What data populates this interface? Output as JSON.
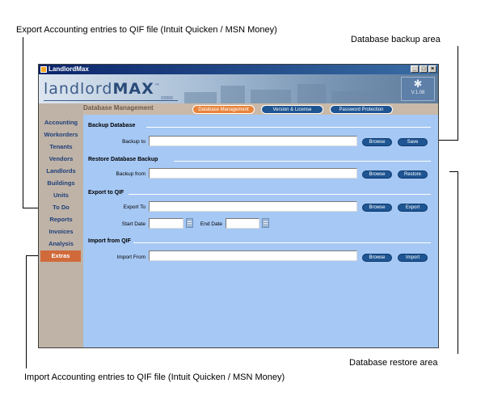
{
  "annotations": {
    "export_callout": "Export Accounting entries to QIF file (Intuit Quicken / MSN Money)",
    "backup_callout": "Database backup area",
    "restore_callout": "Database restore area",
    "import_callout": "Import Accounting entries to QIF file (Intuit Quicken / MSN Money)"
  },
  "window": {
    "title": "LandlordMax",
    "minimize": "_",
    "maximize": "□",
    "close": "×"
  },
  "banner": {
    "logo_text_light": "landlord",
    "logo_text_bold": "MAX",
    "logo_tm": "™",
    "copyright": "©2003",
    "version": "V.1.08",
    "version_icon": "snowflake-icon"
  },
  "header": {
    "section_title": "Database Management",
    "tabs": [
      {
        "label": "Database Management",
        "active": true
      },
      {
        "label": "Version & License",
        "active": false
      },
      {
        "label": "Password Protection",
        "active": false
      }
    ]
  },
  "sidebar": {
    "items": [
      {
        "label": "Accounting",
        "active": false
      },
      {
        "label": "Workorders",
        "active": false
      },
      {
        "label": "Tenants",
        "active": false
      },
      {
        "label": "Vendors",
        "active": false
      },
      {
        "label": "Landlords",
        "active": false
      },
      {
        "label": "Buildings",
        "active": false
      },
      {
        "label": "Units",
        "active": false
      },
      {
        "label": "To Do",
        "active": false
      },
      {
        "label": "Reports",
        "active": false
      },
      {
        "label": "Invoices",
        "active": false
      },
      {
        "label": "Analysis",
        "active": false
      },
      {
        "label": "Extras",
        "active": true
      }
    ]
  },
  "backup": {
    "heading": "Backup Database",
    "label": "Backup to",
    "value": "",
    "browse": "Browse",
    "action": "Save"
  },
  "restore": {
    "heading": "Restore Database Backup",
    "label": "Backup from",
    "value": "",
    "browse": "Browse",
    "action": "Restore"
  },
  "export": {
    "heading": "Export to QIF",
    "label": "Export To",
    "value": "",
    "browse": "Browse",
    "action": "Export",
    "start_label": "Start Date",
    "start_value": "",
    "end_label": "End Date",
    "end_value": ""
  },
  "import": {
    "heading": "Import from QIF",
    "label": "Import From",
    "value": "",
    "browse": "Browse",
    "action": "Import"
  },
  "colors": {
    "content_bg": "#a6c8f4",
    "button_blue": "#1e5592",
    "active_tab": "#e8843c",
    "sidebar_bg": "#bfb3a7",
    "active_nav": "#d06a3a"
  }
}
